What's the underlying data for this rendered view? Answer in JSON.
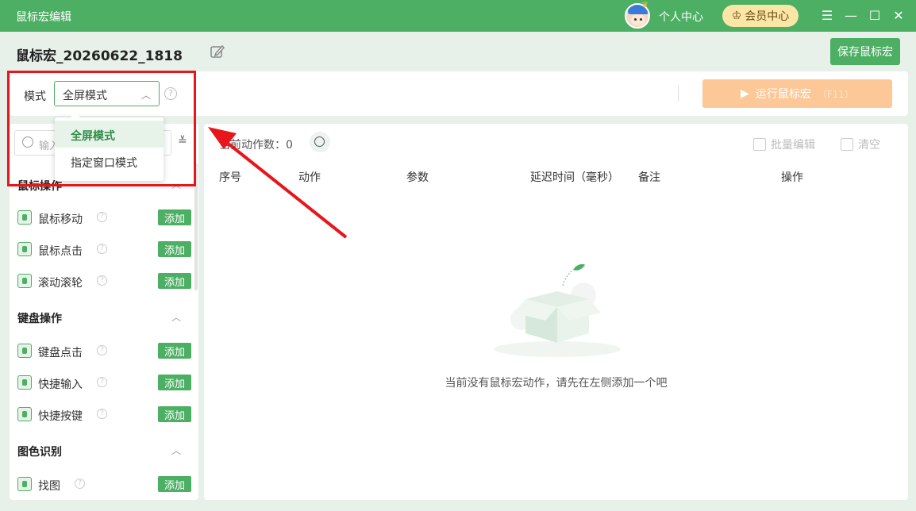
{
  "titlebar": {
    "title": "鼠标宏编辑",
    "personal_center": "个人中心",
    "vip_center": "会员中心",
    "menu_icon": "menu-icon",
    "minimize_icon": "minimize-icon",
    "maximize_icon": "maximize-icon",
    "close_icon": "close-icon"
  },
  "header": {
    "macro_name": "鼠标宏_20260622_1818",
    "save_label": "保存鼠标宏"
  },
  "mode_bar": {
    "label": "模式",
    "selected": "全屏模式",
    "options": [
      "全屏模式",
      "指定窗口模式"
    ],
    "run_label": "运行鼠标宏",
    "run_hotkey": "（F11）"
  },
  "sidebar": {
    "search_placeholder": "输入",
    "sections": [
      {
        "title": "鼠标操作",
        "items": [
          {
            "label": "鼠标移动",
            "add": "添加"
          },
          {
            "label": "鼠标点击",
            "add": "添加"
          },
          {
            "label": "滚动滚轮",
            "add": "添加"
          }
        ]
      },
      {
        "title": "键盘操作",
        "items": [
          {
            "label": "键盘点击",
            "add": "添加"
          },
          {
            "label": "快捷输入",
            "add": "添加"
          },
          {
            "label": "快捷按键",
            "add": "添加"
          }
        ]
      },
      {
        "title": "图色识别",
        "items": [
          {
            "label": "找图",
            "add": "添加"
          }
        ]
      }
    ]
  },
  "main": {
    "count_label": "当前动作数：0",
    "batch_edit": "批量编辑",
    "clear": "清空",
    "columns": [
      "序号",
      "动作",
      "参数",
      "延迟时间（毫秒）",
      "备注",
      "操作"
    ],
    "empty_text": "当前没有鼠标宏动作，请先在左侧添加一个吧"
  },
  "colors": {
    "brand": "#4caf63",
    "run_disabled": "#fcc898",
    "annotation": "#e8161b"
  }
}
